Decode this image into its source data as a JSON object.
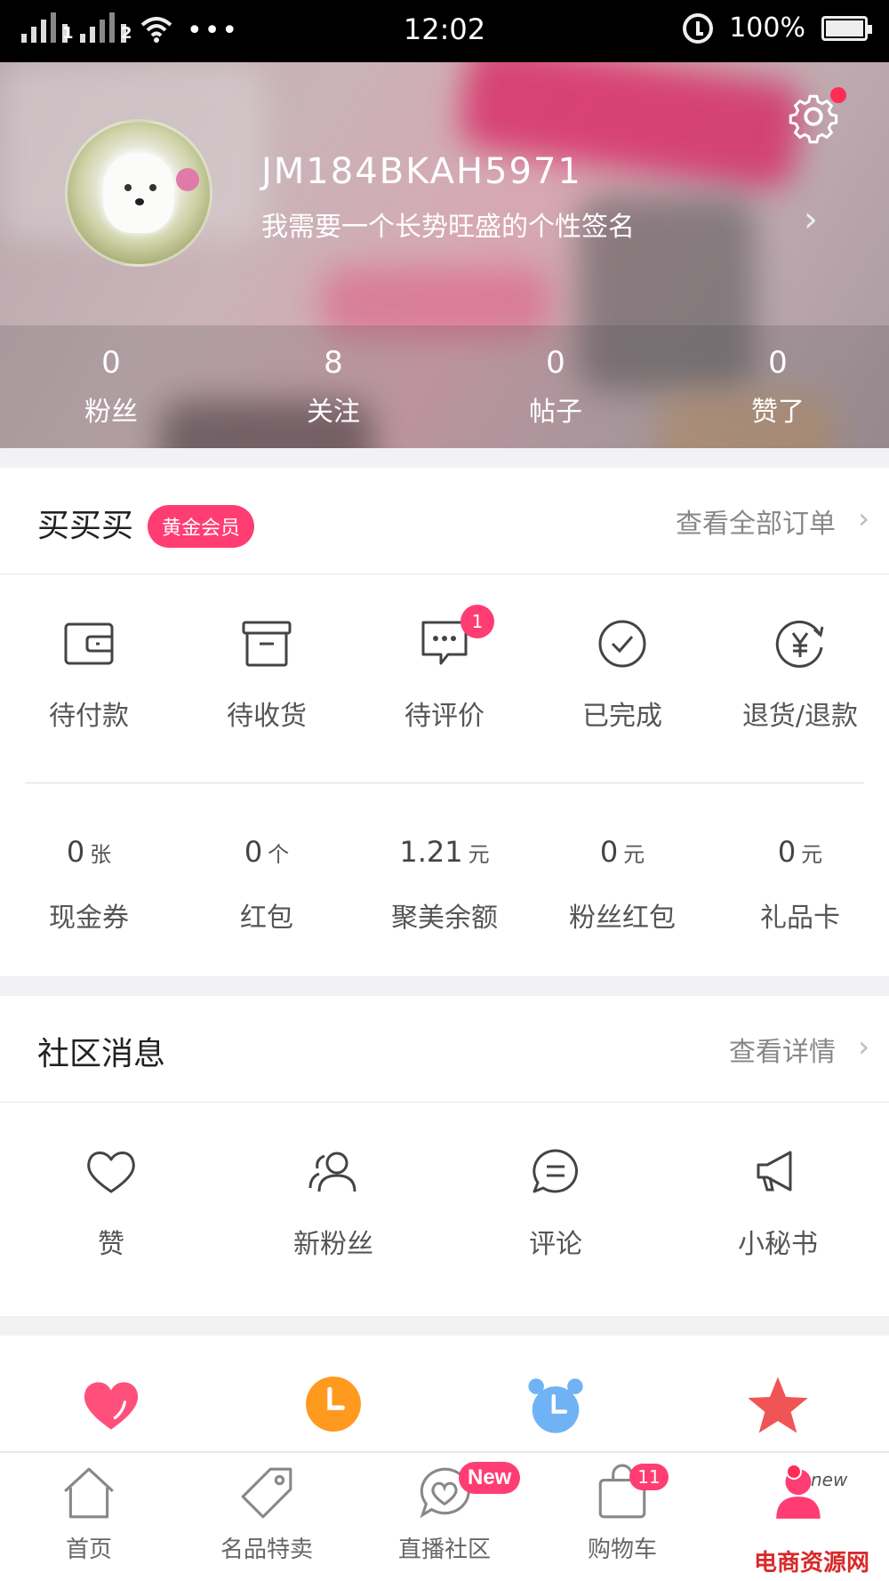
{
  "status_bar": {
    "time": "12:02",
    "battery": "100%",
    "sim1": "1",
    "sim2": "2",
    "dots": "•••"
  },
  "profile": {
    "username": "JM184BKAH5971",
    "signature": "我需要一个长势旺盛的个性签名",
    "stats": [
      {
        "value": "0",
        "label": "粉丝"
      },
      {
        "value": "8",
        "label": "关注"
      },
      {
        "value": "0",
        "label": "帖子"
      },
      {
        "value": "0",
        "label": "赞了"
      }
    ]
  },
  "orders": {
    "title": "买买买",
    "member_badge": "黄金会员",
    "view_all": "查看全部订单",
    "items": [
      {
        "label": "待付款",
        "icon": "wallet-icon"
      },
      {
        "label": "待收货",
        "icon": "box-icon"
      },
      {
        "label": "待评价",
        "icon": "comment-dots-icon",
        "badge": "1"
      },
      {
        "label": "已完成",
        "icon": "check-circle-icon"
      },
      {
        "label": "退货/退款",
        "icon": "refund-yen-icon"
      }
    ],
    "assets": [
      {
        "value": "0",
        "unit": "张",
        "label": "现金券"
      },
      {
        "value": "0",
        "unit": "个",
        "label": "红包"
      },
      {
        "value": "1.21",
        "unit": "元",
        "label": "聚美余额"
      },
      {
        "value": "0",
        "unit": "元",
        "label": "粉丝红包"
      },
      {
        "value": "0",
        "unit": "元",
        "label": "礼品卡"
      }
    ]
  },
  "community": {
    "title": "社区消息",
    "view_detail": "查看详情",
    "items": [
      {
        "label": "赞",
        "icon": "heart-outline-icon"
      },
      {
        "label": "新粉丝",
        "icon": "users-icon"
      },
      {
        "label": "评论",
        "icon": "comment-icon"
      },
      {
        "label": "小秘书",
        "icon": "megaphone-icon"
      }
    ]
  },
  "shortcuts": [
    {
      "icon": "heart-filled-icon",
      "color": "#ff4f7b"
    },
    {
      "icon": "clock-icon",
      "color": "#ff9a1f"
    },
    {
      "icon": "alarm-icon",
      "color": "#6fb3f5"
    },
    {
      "icon": "star-icon",
      "color": "#f05454"
    }
  ],
  "tabbar": {
    "tabs": [
      {
        "label": "首页",
        "icon": "home-icon"
      },
      {
        "label": "名品特卖",
        "icon": "tag-icon"
      },
      {
        "label": "直播社区",
        "icon": "live-heart-icon",
        "pill": "New"
      },
      {
        "label": "购物车",
        "icon": "cart-bag-icon",
        "badge": "11"
      },
      {
        "label": "",
        "icon": "me-icon",
        "tag": "new"
      }
    ]
  },
  "watermark": "电商资源网",
  "colors": {
    "accent": "#ff3d73",
    "badge_dot": "#ff2c55"
  }
}
